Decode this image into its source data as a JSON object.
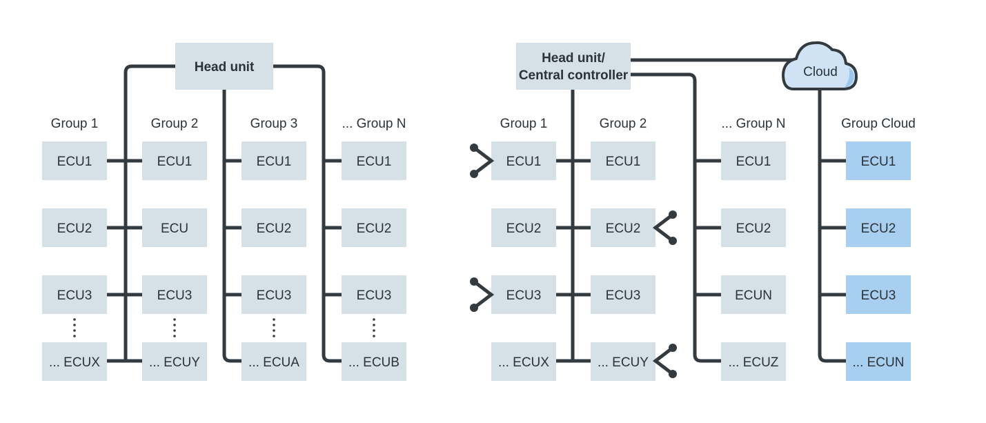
{
  "colors": {
    "box": "#d5e0e7",
    "cloud_box": "#a8cff0",
    "cloud_fill": "#cfe3f5",
    "cloud_shade": "#9cc7ec",
    "wire": "#333a40",
    "text": "#2b3238"
  },
  "left_diagram": {
    "head_unit": "Head unit",
    "groups": [
      {
        "label": "Group 1",
        "ecus": [
          "ECU1",
          "ECU2",
          "ECU3",
          "... ECUX"
        ]
      },
      {
        "label": "Group 2",
        "ecus": [
          "ECU1",
          "ECU",
          "ECU3",
          "... ECUY"
        ]
      },
      {
        "label": "Group 3",
        "ecus": [
          "ECU1",
          "ECU2",
          "ECU3",
          "... ECUA"
        ]
      },
      {
        "label": "... Group N",
        "ecus": [
          "ECU1",
          "ECU2",
          "ECU3",
          "... ECUB"
        ]
      }
    ]
  },
  "right_diagram": {
    "head_unit_line1": "Head unit/",
    "head_unit_line2": "Central controller",
    "cloud": "Cloud",
    "groups": [
      {
        "label": "Group 1",
        "ecus": [
          "ECU1",
          "ECU2",
          "ECU3",
          "... ECUX"
        ]
      },
      {
        "label": "Group 2",
        "ecus": [
          "ECU1",
          "ECU2",
          "ECU3",
          "... ECUY"
        ]
      },
      {
        "label": "... Group N",
        "ecus": [
          "ECU1",
          "ECU2",
          "ECUN",
          "... ECUZ"
        ]
      },
      {
        "label": "Group Cloud",
        "ecus": [
          "ECU1",
          "ECU2",
          "ECU3",
          "... ECUN"
        ]
      }
    ]
  }
}
